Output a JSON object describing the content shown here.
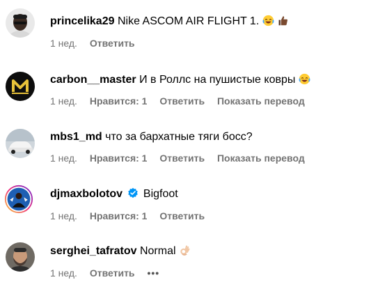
{
  "comments": [
    {
      "username": "princelika29",
      "text": "Nike ASCOM AIR FLIGHT 1.",
      "emojis": [
        "laughing-emoji",
        "thumbs-up-emoji"
      ],
      "time": "1 нед.",
      "likes": "",
      "reply": "Ответить",
      "translate": ""
    },
    {
      "username": "carbon__master",
      "text": "И в Роллс на пушистые ковры",
      "emojis": [
        "laughing-emoji"
      ],
      "time": "1 нед.",
      "likes": "Нравится: 1",
      "reply": "Ответить",
      "translate": "Показать перевод"
    },
    {
      "username": "mbs1_md",
      "text": "что за бархатные тяги босс?",
      "emojis": [],
      "time": "1 нед.",
      "likes": "Нравится: 1",
      "reply": "Ответить",
      "translate": "Показать перевод"
    },
    {
      "username": "djmaxbolotov",
      "verified": true,
      "text": "Bigfoot",
      "emojis": [],
      "time": "1 нед.",
      "likes": "Нравится: 1",
      "reply": "Ответить",
      "translate": ""
    },
    {
      "username": "serghei_tafratov",
      "text": "Normal",
      "emojis": [
        "ok-hand-emoji"
      ],
      "time": "1 нед.",
      "likes": "",
      "reply": "Ответить",
      "translate": "",
      "more": "•••"
    }
  ],
  "colors": {
    "meta": "#737373",
    "verified": "#0095f6",
    "story_ring_start": "#f9ce34",
    "story_ring_end": "#ee2a7b"
  }
}
